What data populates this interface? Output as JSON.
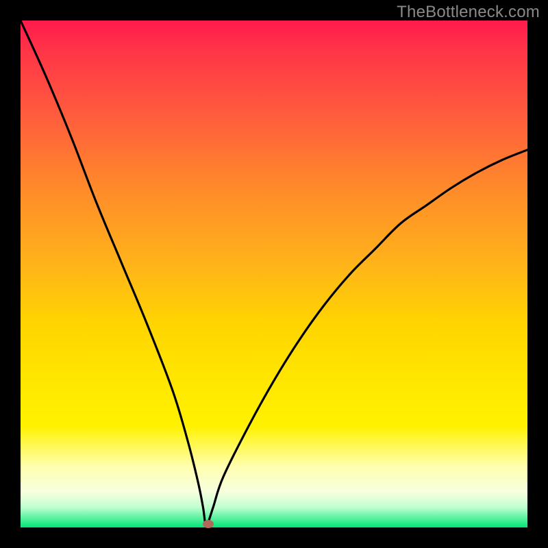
{
  "watermark": "TheBottleneck.com",
  "chart_data": {
    "type": "line",
    "title": "",
    "xlabel": "",
    "ylabel": "",
    "xlim": [
      0,
      100
    ],
    "ylim": [
      0,
      100
    ],
    "grid": false,
    "series": [
      {
        "name": "bottleneck-curve",
        "x": [
          0,
          5,
          10,
          15,
          20,
          25,
          30,
          33,
          35,
          36,
          36.5,
          37,
          38,
          40,
          45,
          50,
          55,
          60,
          65,
          70,
          75,
          80,
          85,
          90,
          95,
          100
        ],
        "values": [
          100,
          89,
          77,
          64,
          52,
          40,
          27,
          17,
          9,
          4,
          0.5,
          1,
          4,
          10,
          20,
          29,
          37,
          44,
          50,
          55,
          60,
          63.5,
          67,
          70,
          72.5,
          74.5
        ]
      }
    ],
    "marker": {
      "x": 37,
      "y": 0.7
    },
    "gradient_stops": [
      {
        "pos": 0,
        "color": "#ff1a4d"
      },
      {
        "pos": 6,
        "color": "#ff3547"
      },
      {
        "pos": 18,
        "color": "#ff5a3e"
      },
      {
        "pos": 33,
        "color": "#ff8a2a"
      },
      {
        "pos": 48,
        "color": "#ffb31a"
      },
      {
        "pos": 60,
        "color": "#ffd500"
      },
      {
        "pos": 70,
        "color": "#ffe500"
      },
      {
        "pos": 80,
        "color": "#fff200"
      },
      {
        "pos": 88,
        "color": "#ffffb0"
      },
      {
        "pos": 93,
        "color": "#f7ffde"
      },
      {
        "pos": 96,
        "color": "#c0ffd0"
      },
      {
        "pos": 100,
        "color": "#00e676"
      }
    ]
  }
}
